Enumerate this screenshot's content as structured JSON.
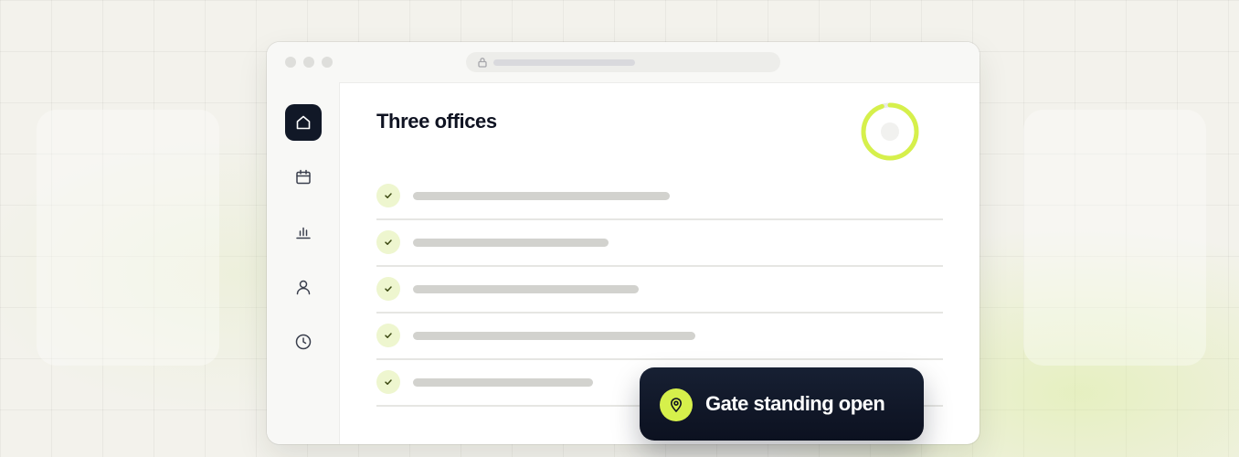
{
  "colors": {
    "accent": "#d6f04b",
    "dark": "#111827",
    "check_bg": "#eef6cf",
    "skeleton": "#d2d2ce"
  },
  "sidebar": {
    "items": [
      {
        "icon": "home-icon",
        "active": true
      },
      {
        "icon": "calendar-icon",
        "active": false
      },
      {
        "icon": "bar-chart-icon",
        "active": false
      },
      {
        "icon": "user-icon",
        "active": false
      },
      {
        "icon": "clock-icon",
        "active": false
      }
    ]
  },
  "main": {
    "title": "Three offices",
    "progress": 0.95,
    "tasks": [
      {
        "checked": true,
        "text_length": 0.5
      },
      {
        "checked": true,
        "text_length": 0.38
      },
      {
        "checked": true,
        "text_length": 0.44
      },
      {
        "checked": true,
        "text_length": 0.55
      },
      {
        "checked": true,
        "text_length": 0.35
      }
    ]
  },
  "toast": {
    "icon": "map-pin-icon",
    "text": "Gate standing open"
  }
}
